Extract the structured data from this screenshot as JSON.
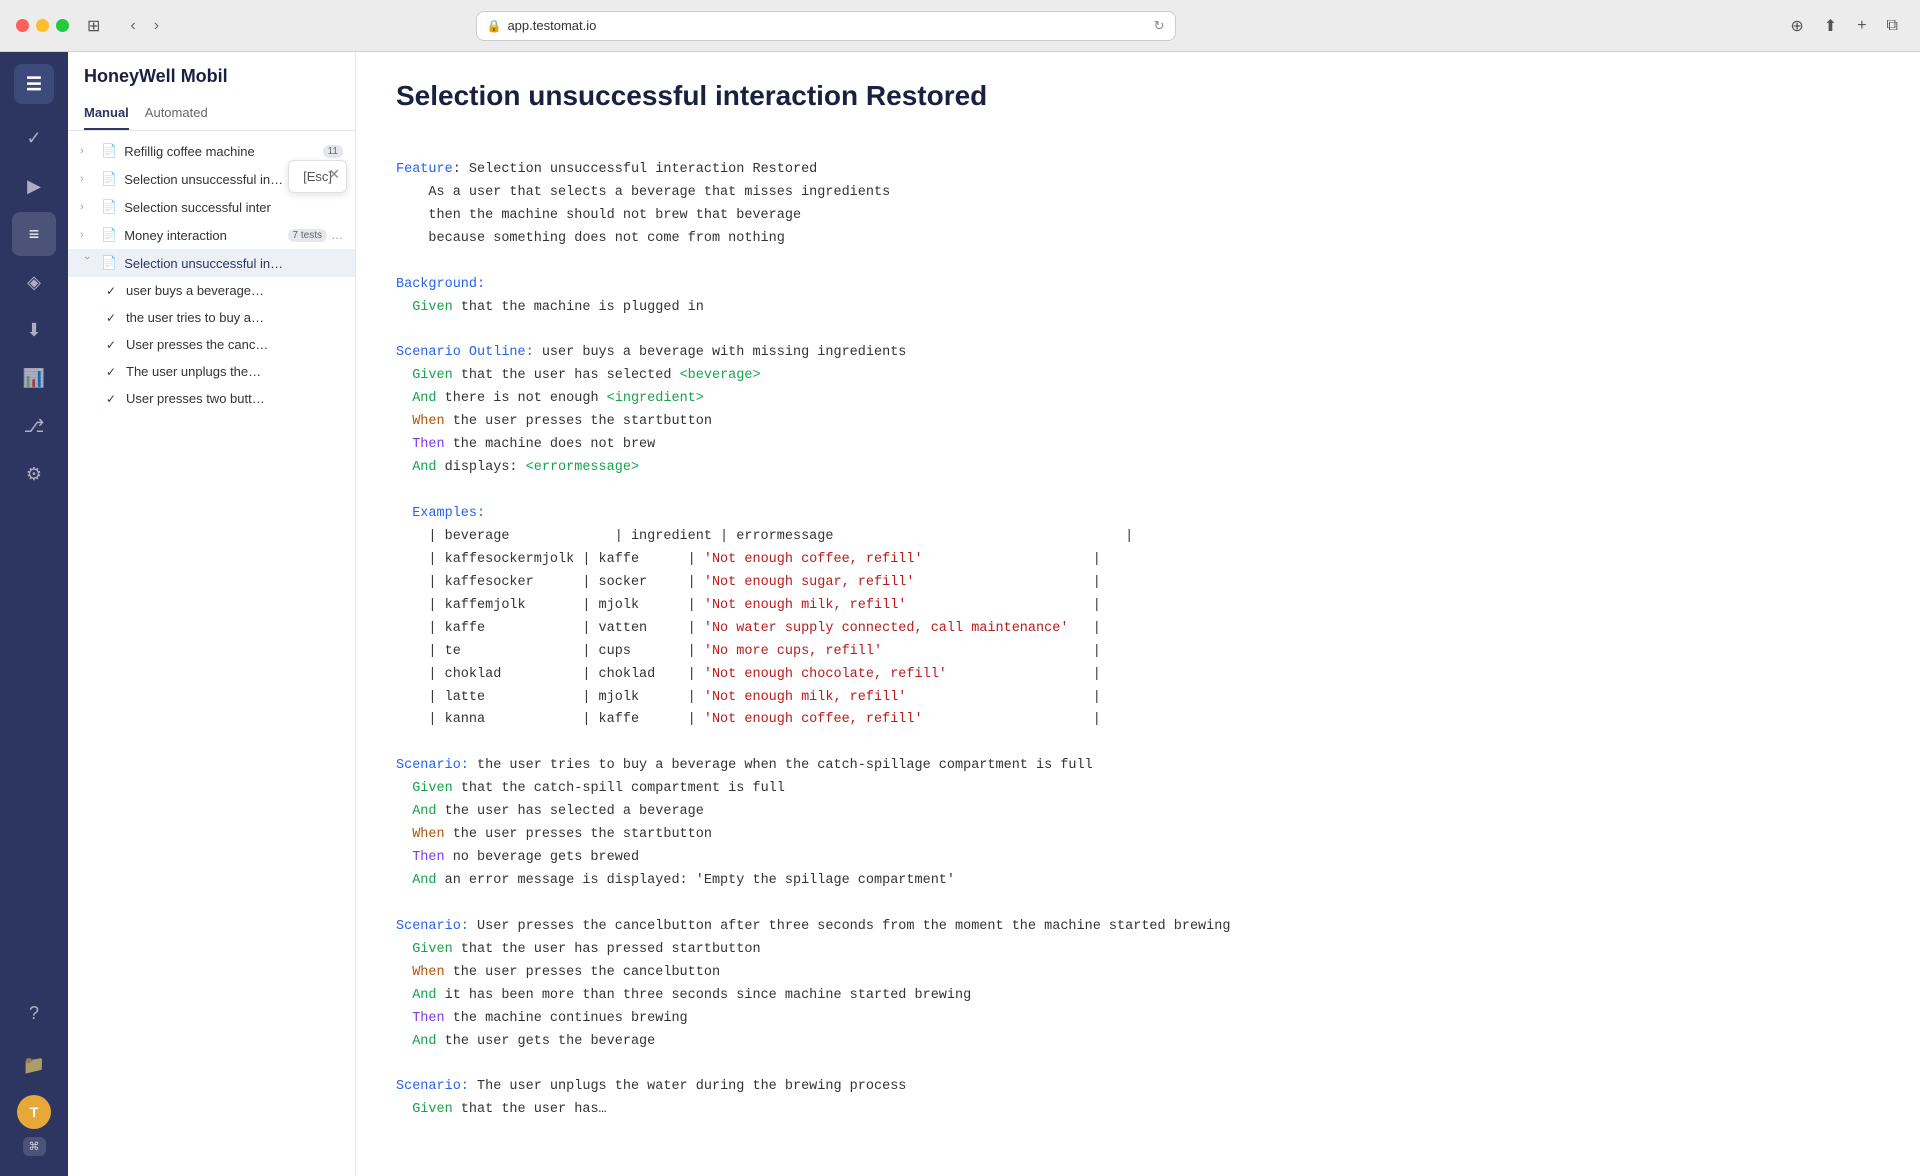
{
  "browser": {
    "url": "app.testomat.io",
    "tab_title": "app.testomat.io"
  },
  "app": {
    "project_name": "HoneyWell Mobil",
    "sidebar_items": [
      {
        "id": "menu",
        "icon": "☰",
        "label": "Menu",
        "active": false
      },
      {
        "id": "check",
        "icon": "✓",
        "label": "Dashboard",
        "active": true
      },
      {
        "id": "play",
        "icon": "▶",
        "label": "Run",
        "active": false
      },
      {
        "id": "list",
        "icon": "≡",
        "label": "Tests",
        "active": false
      },
      {
        "id": "layers",
        "icon": "◈",
        "label": "Suites",
        "active": false
      },
      {
        "id": "import",
        "icon": "⬇",
        "label": "Import",
        "active": false
      },
      {
        "id": "chart",
        "icon": "📊",
        "label": "Reports",
        "active": false
      },
      {
        "id": "git",
        "icon": "⎇",
        "label": "Git",
        "active": false
      },
      {
        "id": "settings",
        "icon": "⚙",
        "label": "Settings",
        "active": false
      }
    ],
    "bottom_items": [
      {
        "id": "help",
        "icon": "?",
        "label": "Help"
      },
      {
        "id": "files",
        "icon": "📁",
        "label": "Files"
      }
    ],
    "user_avatar": "T"
  },
  "tree": {
    "title": "HoneyWell Mobil",
    "tabs": [
      {
        "id": "manual",
        "label": "Manual",
        "active": true
      },
      {
        "id": "automated",
        "label": "Automated",
        "active": false
      }
    ],
    "items": [
      {
        "id": "item-1",
        "type": "suite",
        "label": "Refillig coffee machine",
        "badge": "11",
        "expanded": false,
        "indent": 0
      },
      {
        "id": "item-2",
        "type": "suite",
        "label": "Selection unsuccessful in…",
        "badge": "",
        "expanded": false,
        "indent": 0
      },
      {
        "id": "item-3",
        "type": "suite",
        "label": "Selection successful inter",
        "badge": "",
        "expanded": false,
        "indent": 0
      },
      {
        "id": "item-4",
        "type": "suite",
        "label": "Money interaction",
        "badge": "7 tests",
        "extra": "…",
        "expanded": false,
        "indent": 0
      },
      {
        "id": "item-5",
        "type": "suite",
        "label": "Selection unsuccessful in…",
        "badge": "",
        "expanded": true,
        "indent": 0
      },
      {
        "id": "sub-1",
        "type": "test",
        "label": "user buys a beverage…",
        "indent": 1,
        "checked": true
      },
      {
        "id": "sub-2",
        "type": "test",
        "label": "the user tries to buy a…",
        "indent": 1,
        "checked": true
      },
      {
        "id": "sub-3",
        "type": "test",
        "label": "User presses the canc…",
        "indent": 1,
        "checked": true
      },
      {
        "id": "sub-4",
        "type": "test",
        "label": "The user unplugs the…",
        "indent": 1,
        "checked": true
      },
      {
        "id": "sub-5",
        "type": "test",
        "label": "User presses two butt…",
        "indent": 1,
        "checked": true
      }
    ],
    "tooltip": {
      "text": "[Esc]",
      "visible": true
    }
  },
  "main": {
    "title": "Selection unsuccessful interaction Restored",
    "code": {
      "feature_line": "Feature: Selection unsuccessful interaction Restored",
      "description_lines": [
        "    As a user that selects a beverage that misses ingredients",
        "    then the machine should not brew that beverage",
        "    because something does not come from nothing"
      ],
      "background_section": {
        "label": "Background:",
        "given": "Given",
        "given_text": " that the machine is plugged in"
      },
      "scenario_outline": {
        "label": "Scenario Outline:",
        "text": " user buys a beverage with missing ingredients",
        "steps": [
          {
            "kw": "Given",
            "text": " that the user has selected ",
            "param": "<beverage>"
          },
          {
            "kw": "And",
            "text": " there is not enough ",
            "param": "<ingredient>"
          },
          {
            "kw": "When",
            "text": " the user presses the startbutton"
          },
          {
            "kw": "Then",
            "text": " the machine does not brew"
          },
          {
            "kw": "And",
            "text": " displays: ",
            "param": "<errormessage>"
          }
        ],
        "examples_label": "Examples:",
        "table_header": "| beverage             | ingredient | errormessage                                    |",
        "table_rows": [
          "| kaffesockermjolk | kaffe      | 'Not enough coffee, refill'                     |",
          "| kaffesocker      | socker     | 'Not enough sugar, refill'                      |",
          "| kaffemjolk       | mjolk      | 'Not enough milk, refill'                       |",
          "| kaffe            | vatten     | 'No water supply connected, call maintenance'   |",
          "| te               | cups       | 'No more cups, refill'                          |",
          "| choklad          | choklad    | 'Not enough chocolate, refill'                  |",
          "| latte            | mjolk      | 'Not enough milk, refill'                       |",
          "| kanna            | kaffe      | 'Not enough coffee, refill'                     |"
        ]
      },
      "scenarios": [
        {
          "label": "Scenario:",
          "text": " the user tries to buy a beverage when the catch-spillage compartment is full",
          "steps": [
            {
              "kw": "Given",
              "text": " that the catch-spill compartment is full"
            },
            {
              "kw": "And",
              "text": " the user has selected a beverage"
            },
            {
              "kw": "When",
              "text": " the user presses the startbutton"
            },
            {
              "kw": "Then",
              "text": " no beverage gets brewed"
            },
            {
              "kw": "And",
              "text": " an error message is displayed: 'Empty the spillage compartment'"
            }
          ]
        },
        {
          "label": "Scenario:",
          "text": " User presses the cancelbutton after three seconds from the moment the machine started brewing",
          "steps": [
            {
              "kw": "Given",
              "text": " that the user has pressed startbutton"
            },
            {
              "kw": "When",
              "text": " the user presses the cancelbutton"
            },
            {
              "kw": "And",
              "text": " it has been more than three seconds since machine started brewing"
            },
            {
              "kw": "Then",
              "text": " the machine continues brewing"
            },
            {
              "kw": "And",
              "text": " the user gets the beverage"
            }
          ]
        },
        {
          "label": "Scenario:",
          "text": " The user unplugs the water during the brewing process",
          "steps": [
            {
              "kw": "Given",
              "text": " that the user has…"
            }
          ]
        }
      ]
    }
  }
}
